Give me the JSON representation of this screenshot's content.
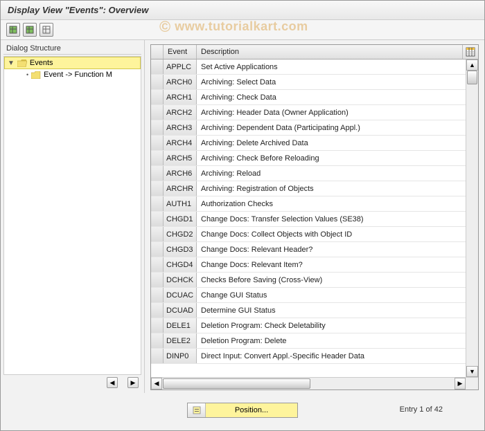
{
  "title": "Display View \"Events\": Overview",
  "watermark": "www.tutorialkart.com",
  "sidebar": {
    "title": "Dialog Structure",
    "items": [
      {
        "label": "Events",
        "selected": true
      },
      {
        "label": "Event -> Function M"
      }
    ]
  },
  "table": {
    "headers": {
      "event": "Event",
      "desc": "Description"
    },
    "rows": [
      {
        "event": "APPLC",
        "desc": "Set Active Applications"
      },
      {
        "event": "ARCH0",
        "desc": "Archiving: Select Data"
      },
      {
        "event": "ARCH1",
        "desc": "Archiving: Check Data"
      },
      {
        "event": "ARCH2",
        "desc": "Archiving: Header Data (Owner Application)"
      },
      {
        "event": "ARCH3",
        "desc": "Archiving: Dependent Data (Participating Appl.)"
      },
      {
        "event": "ARCH4",
        "desc": "Archiving: Delete Archived Data"
      },
      {
        "event": "ARCH5",
        "desc": "Archiving: Check Before Reloading"
      },
      {
        "event": "ARCH6",
        "desc": "Archiving: Reload"
      },
      {
        "event": "ARCHR",
        "desc": "Archiving: Registration of Objects"
      },
      {
        "event": "AUTH1",
        "desc": "Authorization Checks"
      },
      {
        "event": "CHGD1",
        "desc": "Change Docs: Transfer Selection Values (SE38)"
      },
      {
        "event": "CHGD2",
        "desc": "Change Docs: Collect Objects with Object ID"
      },
      {
        "event": "CHGD3",
        "desc": "Change Docs: Relevant Header?"
      },
      {
        "event": "CHGD4",
        "desc": "Change Docs: Relevant Item?"
      },
      {
        "event": "DCHCK",
        "desc": "Checks Before Saving (Cross-View)"
      },
      {
        "event": "DCUAC",
        "desc": "Change GUI Status"
      },
      {
        "event": "DCUAD",
        "desc": "Determine GUI Status"
      },
      {
        "event": "DELE1",
        "desc": "Deletion Program: Check Deletability"
      },
      {
        "event": "DELE2",
        "desc": "Deletion Program: Delete"
      },
      {
        "event": "DINP0",
        "desc": "Direct Input: Convert Appl.-Specific Header Data"
      }
    ]
  },
  "footer": {
    "position_label": "Position...",
    "entry_text": "Entry 1 of 42"
  }
}
